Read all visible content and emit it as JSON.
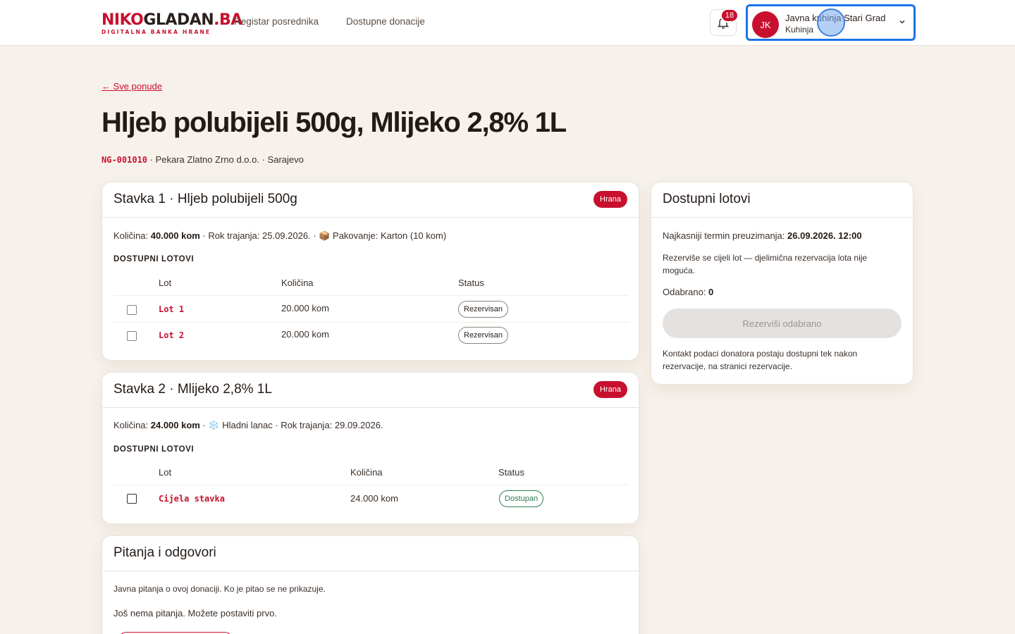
{
  "header": {
    "logo": {
      "part1": "NIKO",
      "part2": "GLADAN",
      "part3": ".BA",
      "tagline": "DIGITALNA BANKA HRANE"
    },
    "nav": [
      "Registar posrednika",
      "Dostupne donacije"
    ],
    "notifications_count": "18",
    "user": {
      "initials": "JK",
      "name": "Javna kuhinja Stari Grad",
      "role": "Kuhinja"
    }
  },
  "page": {
    "back_link": "← Sve ponude",
    "title": "Hljeb polubijeli 500g, Mlijeko 2,8% 1L",
    "code": "NG-001010",
    "meta_rest": " · Pekara Zlatno Zrno d.o.o. · Sarajevo"
  },
  "items": [
    {
      "title": "Stavka 1 · Hljeb polubijeli 500g",
      "tag": "Hrana",
      "qty_label": "Količina: ",
      "qty": "40.000 kom",
      "details": " · Rok trajanja: 25.09.2026. · 📦 Pakovanje: Karton (10 kom)",
      "lots_label": "DOSTUPNI LOTOVI",
      "columns": [
        "Lot",
        "Količina",
        "Status"
      ],
      "lots": [
        {
          "name": "Lot 1",
          "qty": "20.000 kom",
          "status": "Rezervisan"
        },
        {
          "name": "Lot 2",
          "qty": "20.000 kom",
          "status": "Rezervisan"
        }
      ]
    },
    {
      "title": "Stavka 2 · Mlijeko 2,8% 1L",
      "tag": "Hrana",
      "qty_label": "Količina: ",
      "qty": "24.000 kom",
      "details": " · ❄️ Hladni lanac · Rok trajanja: 29.09.2026.",
      "lots_label": "DOSTUPNI LOTOVI",
      "columns": [
        "Lot",
        "Količina",
        "Status"
      ],
      "lots": [
        {
          "name": "Cijela stavka",
          "qty": "24.000 kom",
          "status": "Dostupan"
        }
      ]
    }
  ],
  "qa": {
    "title": "Pitanja i odgovori",
    "intro": "Javna pitanja o ovoj donaciji. Ko je pitao se ne prikazuje.",
    "empty": "Još nema pitanja. Možete postaviti prvo."
  },
  "sidebar": {
    "title": "Dostupni lotovi",
    "deadline_label": "Najkasniji termin preuzimanja: ",
    "deadline": "26.09.2026. 12:00",
    "note": "Rezerviše se cijeli lot — djelimična rezervacija lota nije moguća.",
    "selected_label": "Odabrano: ",
    "selected": "0",
    "reserve_button": "Rezerviši odabrano",
    "contact_note": "Kontakt podaci donatora postaju dostupni tek nakon rezervacije, na stranici rezervacije."
  },
  "colors": {
    "brand": "#c8102e",
    "background": "#f7f1eb",
    "focus": "#1a73e8",
    "available": "#2e7d4f"
  }
}
